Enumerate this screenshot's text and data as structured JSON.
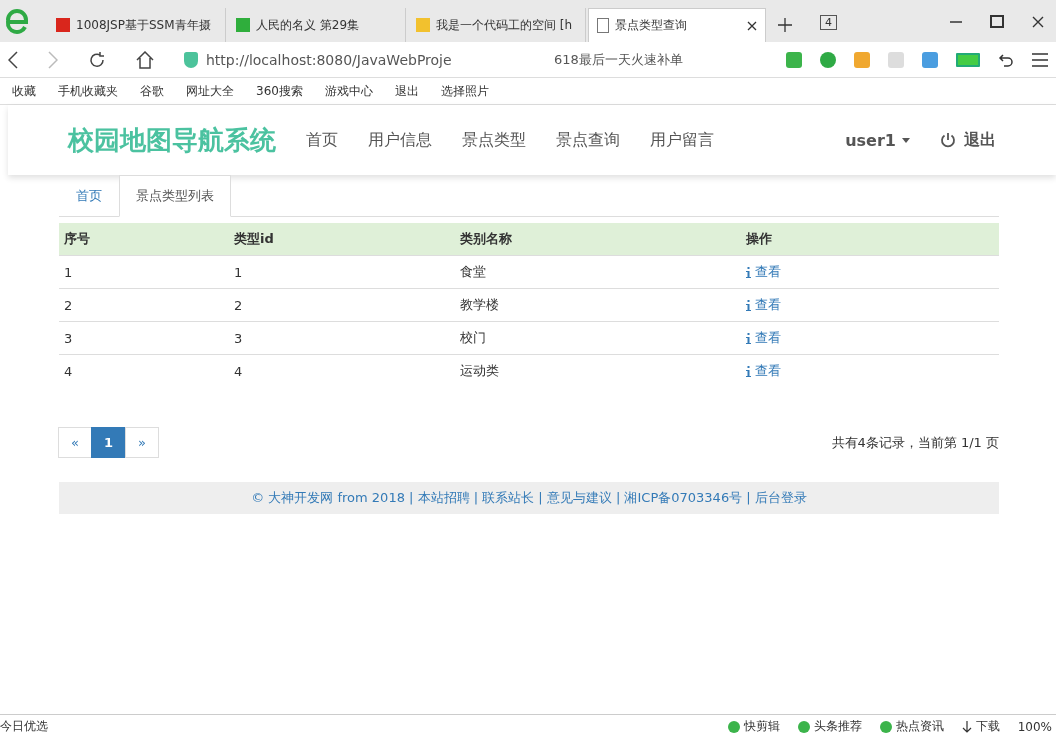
{
  "browser": {
    "tabs": [
      {
        "title": "1008JSP基于SSM青年摄",
        "selected": false
      },
      {
        "title": "人民的名义 第29集",
        "selected": false
      },
      {
        "title": "我是一个代码工的空间 [h",
        "selected": false
      },
      {
        "title": "景点类型查询",
        "selected": true
      }
    ],
    "tab_count": "4",
    "address": "http://localhost:8080/JavaWebProje",
    "search": "618最后一天火速补单",
    "bookmarks": [
      "收藏",
      "手机收藏夹",
      "谷歌",
      "网址大全",
      "360搜索",
      "游戏中心",
      "退出",
      "选择照片"
    ]
  },
  "navbar": {
    "brand": "校园地图导航系统",
    "items": [
      "首页",
      "用户信息",
      "景点类型",
      "景点查询",
      "用户留言"
    ],
    "user": "user1",
    "logout": "退出"
  },
  "breadcrumb_tabs": [
    {
      "label": "首页",
      "selected": false
    },
    {
      "label": "景点类型列表",
      "selected": true
    }
  ],
  "table": {
    "columns": [
      "序号",
      "类型id",
      "类别名称",
      "操作"
    ],
    "rows": [
      {
        "index": "1",
        "id": "1",
        "name": "食堂",
        "action": "查看"
      },
      {
        "index": "2",
        "id": "2",
        "name": "教学楼",
        "action": "查看"
      },
      {
        "index": "3",
        "id": "3",
        "name": "校门",
        "action": "查看"
      },
      {
        "index": "4",
        "id": "4",
        "name": "运动类",
        "action": "查看"
      }
    ]
  },
  "pagination": {
    "prev": "«",
    "pages": [
      {
        "label": "1",
        "selected": true
      }
    ],
    "next": "»",
    "summary": "共有4条记录，当前第 1/1 页"
  },
  "footer": "© 大神开发网 from 2018 | 本站招聘 | 联系站长 | 意见与建议 | 湘ICP备0703346号 | 后台登录",
  "status_bar": {
    "left": "今日优选",
    "items": [
      "快剪辑",
      "头条推荐",
      "热点资讯"
    ],
    "download": "下载",
    "zoom": "100%"
  }
}
